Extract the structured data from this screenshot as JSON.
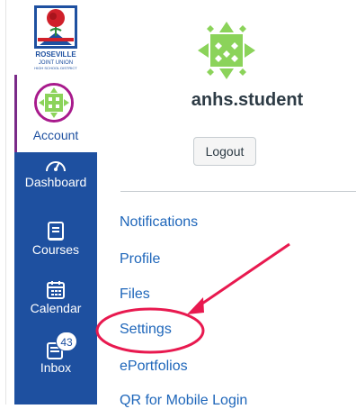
{
  "sidebar": {
    "brand": {
      "logo_line1": "ROSEVILLE",
      "logo_line2": "JOINT UNION",
      "logo_line3": "HIGH SCHOOL DISTRICT"
    },
    "items": [
      {
        "label": "Account",
        "icon": "avatar"
      },
      {
        "label": "Dashboard",
        "icon": "gauge-icon"
      },
      {
        "label": "Courses",
        "icon": "book-icon"
      },
      {
        "label": "Calendar",
        "icon": "calendar-icon"
      },
      {
        "label": "Inbox",
        "icon": "inbox-icon",
        "badge": "43"
      }
    ]
  },
  "tray": {
    "username": "anhs.student",
    "logout_label": "Logout",
    "links": [
      "Notifications",
      "Profile",
      "Files",
      "Settings",
      "ePortfolios",
      "QR for Mobile Login"
    ]
  },
  "colors": {
    "nav_bg": "#1e50a0",
    "link": "#1e66ba",
    "annotation": "#e8194f",
    "avatar_green": "#8bd35a"
  }
}
